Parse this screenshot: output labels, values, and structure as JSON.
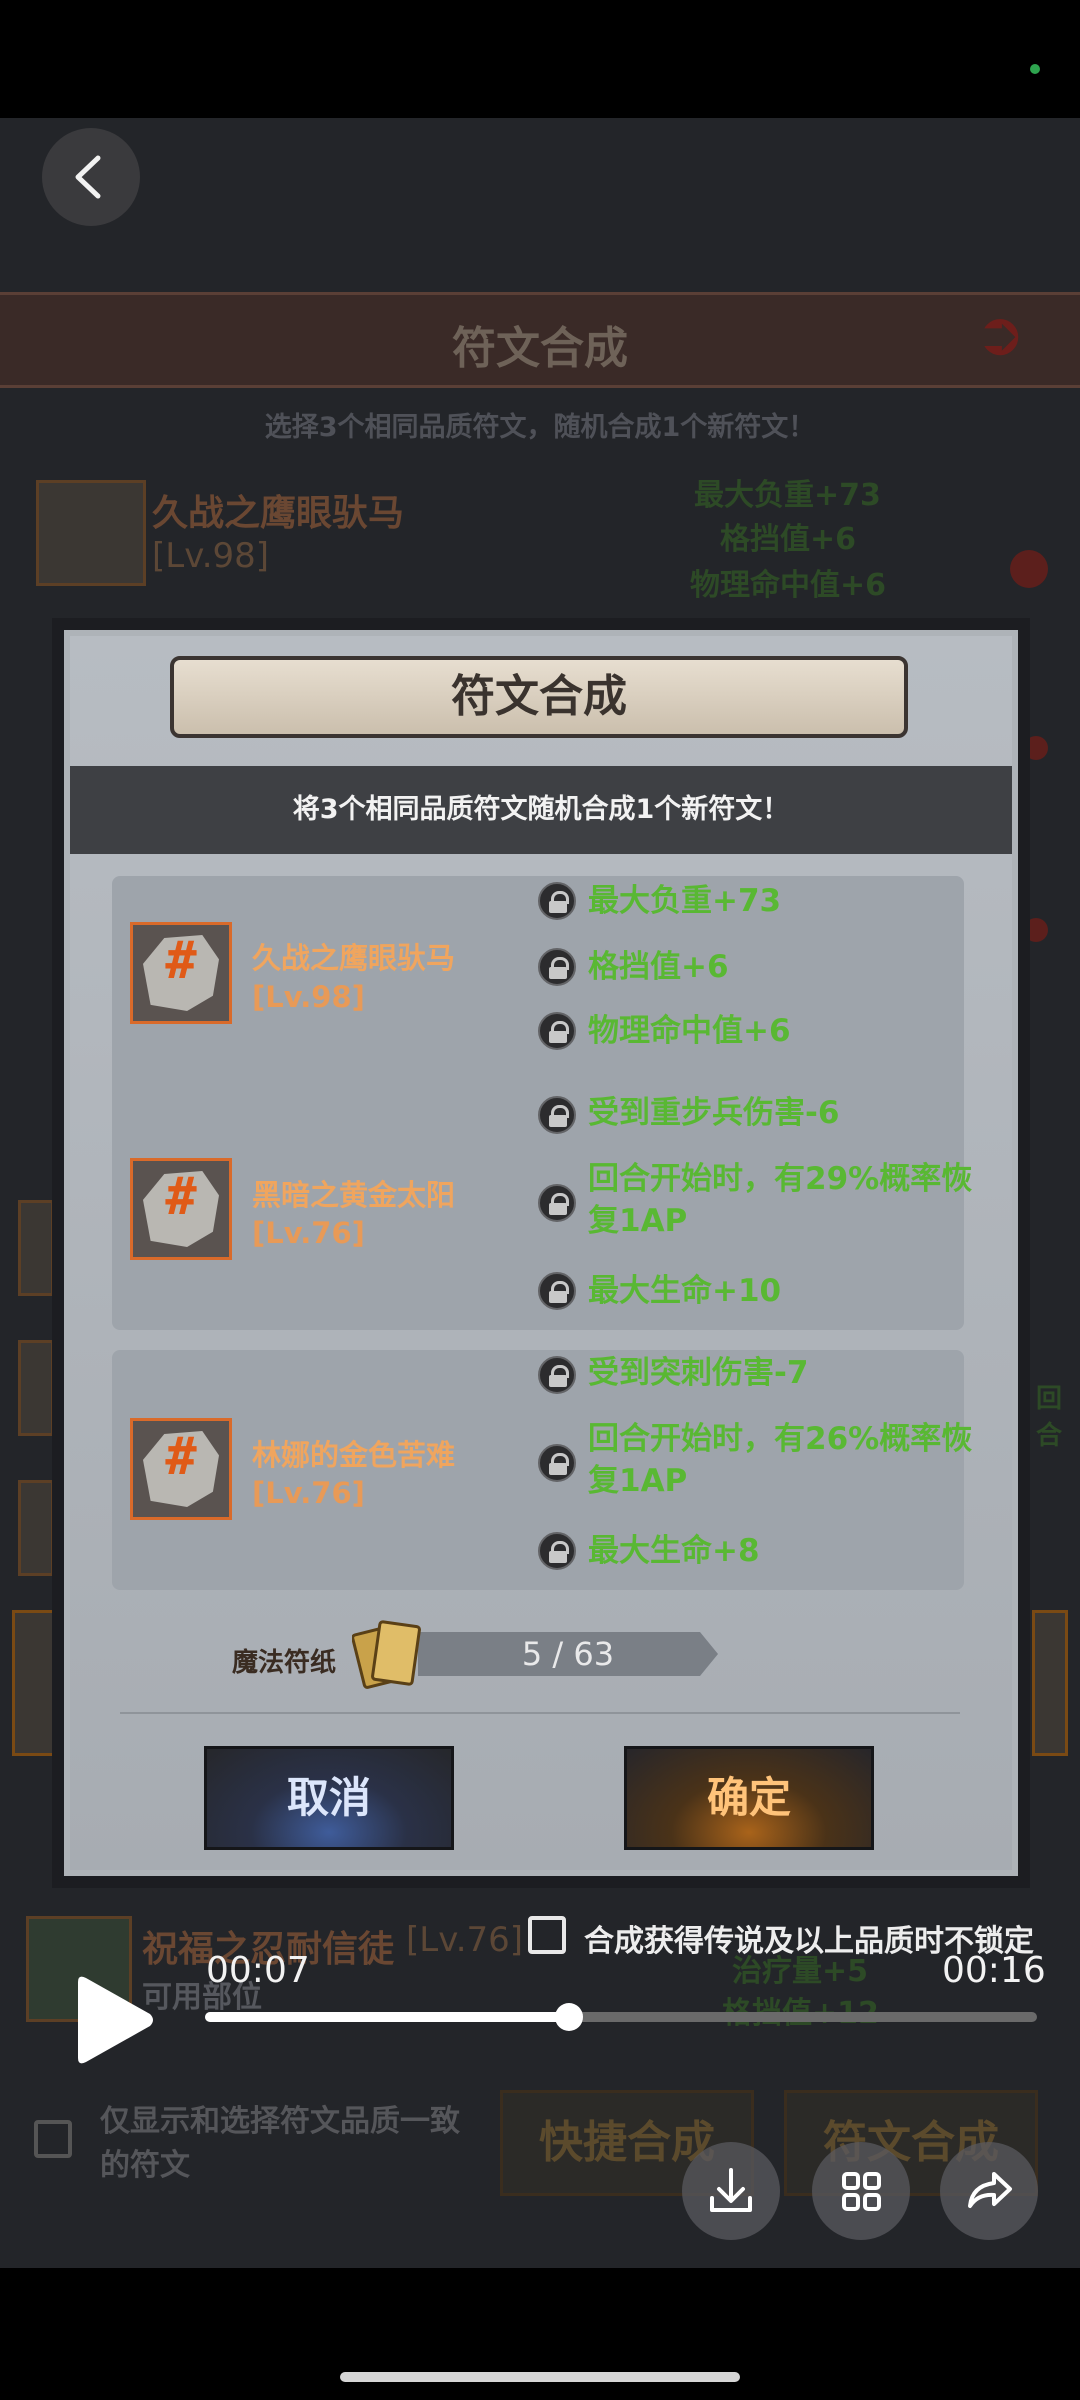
{
  "background": {
    "header_title": "符文合成",
    "subtitle": "选择3个相同品质符文，随机合成1个新符文！",
    "top_rune": {
      "name": "久战之鹰眼驮马",
      "level": "[Lv.98]",
      "stats": [
        "最大负重+73",
        "格挡值+6",
        "物理命中值+6"
      ]
    },
    "bottom_rune": {
      "name": "祝福之忍耐信徒",
      "level": "[Lv.76]",
      "sub": "可用部位",
      "stats": [
        "治疗量+5",
        "格挡值+12"
      ]
    },
    "right_edge_text": "回合",
    "filter_label": "仅显示和选择符文品质一致的符文",
    "quick_button": "快捷合成",
    "synth_button": "符文合成"
  },
  "modal": {
    "title": "符文合成",
    "instruction": "将3个相同品质符文随机合成1个新符文！",
    "runes": [
      {
        "name": "久战之鹰眼驮马",
        "level": "[Lv.98]",
        "stats": [
          "最大负重+73",
          "格挡值+6",
          "物理命中值+6"
        ]
      },
      {
        "name": "黑暗之黄金太阳",
        "level": "[Lv.76]",
        "stats": [
          "受到重步兵伤害-6",
          "回合开始时，有29%概率恢复1AP",
          "最大生命+10"
        ]
      },
      {
        "name": "林娜的金色苦难",
        "level": "[Lv.76]",
        "stats": [
          "受到突刺伤害-7",
          "回合开始时，有26%概率恢复1AP",
          "最大生命+8"
        ]
      }
    ],
    "paper_label": "魔法符纸",
    "paper_count": "5 / 63",
    "cancel": "取消",
    "confirm": "确定"
  },
  "player": {
    "lock_option": "合成获得传说及以上品质时不锁定",
    "current_time": "00:07",
    "total_time": "00:16",
    "progress": 0.4375
  },
  "icons": {
    "back": "chevron-left-icon",
    "play": "play-icon",
    "download": "download-icon",
    "grid": "grid-icon",
    "share": "share-icon",
    "lock": "padlock-icon",
    "rune": "rune-stone-icon",
    "paper": "scroll-paper-icon"
  },
  "colors": {
    "stat_green": "#59b833",
    "rune_orange": "#f0a55e",
    "cancel_blue": "#3f5c9a",
    "confirm_orange": "#a9631a"
  }
}
